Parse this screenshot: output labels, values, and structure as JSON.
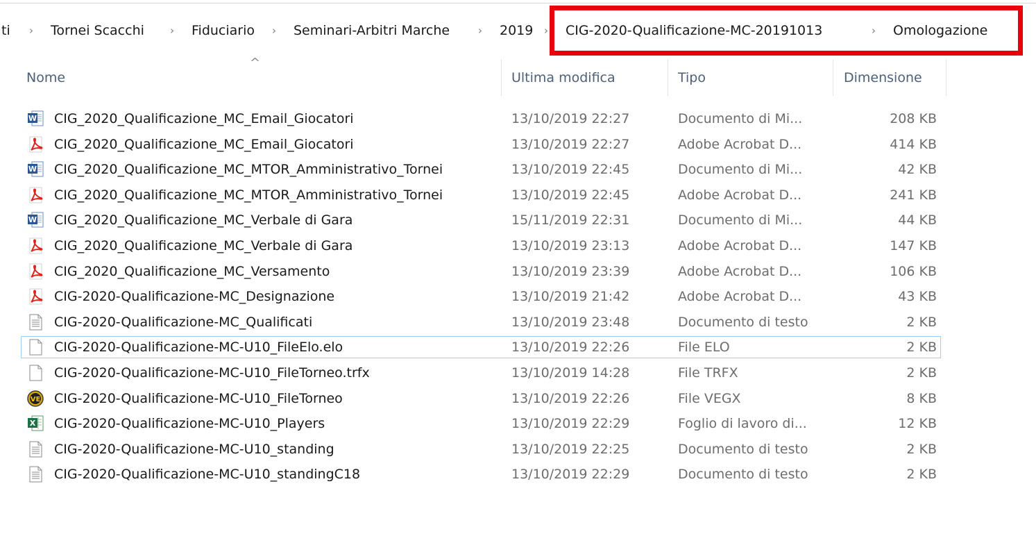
{
  "breadcrumb": {
    "items": [
      "ti",
      "Tornei Scacchi",
      "Fiduciario",
      "Seminari-Arbitri Marche",
      "2019",
      "CIG-2020-Qualificazione-MC-20191013",
      "Omologazione"
    ],
    "separator": "›",
    "highlight_color": "#e8000b"
  },
  "columns": {
    "name": "Nome",
    "date": "Ultima modifica",
    "type": "Tipo",
    "size": "Dimensione",
    "sort_indicator": "^"
  },
  "files": [
    {
      "name": "CIG_2020_Qualificazione_MC_Email_Giocatori",
      "date": "13/10/2019 22:27",
      "type": "Documento di Mi...",
      "size": "208 KB",
      "icon": "word-icon"
    },
    {
      "name": "CIG_2020_Qualificazione_MC_Email_Giocatori",
      "date": "13/10/2019 22:27",
      "type": "Adobe Acrobat D...",
      "size": "414 KB",
      "icon": "pdf-icon"
    },
    {
      "name": "CIG_2020_Qualificazione_MC_MTOR_Amministrativo_Tornei",
      "date": "13/10/2019 22:45",
      "type": "Documento di Mi...",
      "size": "42 KB",
      "icon": "word-icon"
    },
    {
      "name": "CIG_2020_Qualificazione_MC_MTOR_Amministrativo_Tornei",
      "date": "13/10/2019 22:45",
      "type": "Adobe Acrobat D...",
      "size": "241 KB",
      "icon": "pdf-icon"
    },
    {
      "name": "CIG_2020_Qualificazione_MC_Verbale di Gara",
      "date": "15/11/2019 22:31",
      "type": "Documento di Mi...",
      "size": "44 KB",
      "icon": "word-icon"
    },
    {
      "name": "CIG_2020_Qualificazione_MC_Verbale di Gara",
      "date": "13/10/2019 23:13",
      "type": "Adobe Acrobat D...",
      "size": "147 KB",
      "icon": "pdf-icon"
    },
    {
      "name": "CIG_2020_Qualificazione_MC_Versamento",
      "date": "13/10/2019 23:39",
      "type": "Adobe Acrobat D...",
      "size": "106 KB",
      "icon": "pdf-icon"
    },
    {
      "name": "CIG-2020-Qualificazione-MC_Designazione",
      "date": "13/10/2019 21:42",
      "type": "Adobe Acrobat D...",
      "size": "43 KB",
      "icon": "pdf-icon"
    },
    {
      "name": "CIG-2020-Qualificazione-MC_Qualificati",
      "date": "13/10/2019 23:48",
      "type": "Documento di testo",
      "size": "2 KB",
      "icon": "text-file-icon"
    },
    {
      "name": "CIG-2020-Qualificazione-MC-U10_FileElo.elo",
      "date": "13/10/2019 22:26",
      "type": "File ELO",
      "size": "2 KB",
      "icon": "blank-file-icon",
      "selected": true
    },
    {
      "name": "CIG-2020-Qualificazione-MC-U10_FileTorneo.trfx",
      "date": "13/10/2019 14:28",
      "type": "File TRFX",
      "size": "2 KB",
      "icon": "blank-file-icon"
    },
    {
      "name": "CIG-2020-Qualificazione-MC-U10_FileTorneo",
      "date": "13/10/2019 22:26",
      "type": "File VEGX",
      "size": "8 KB",
      "icon": "vega-icon"
    },
    {
      "name": "CIG-2020-Qualificazione-MC-U10_Players",
      "date": "13/10/2019 22:29",
      "type": "Foglio di lavoro di...",
      "size": "12 KB",
      "icon": "excel-icon"
    },
    {
      "name": "CIG-2020-Qualificazione-MC-U10_standing",
      "date": "13/10/2019 22:25",
      "type": "Documento di testo",
      "size": "2 KB",
      "icon": "text-file-icon"
    },
    {
      "name": "CIG-2020-Qualificazione-MC-U10_standingC18",
      "date": "13/10/2019 22:29",
      "type": "Documento di testo",
      "size": "2 KB",
      "icon": "text-file-icon"
    }
  ]
}
